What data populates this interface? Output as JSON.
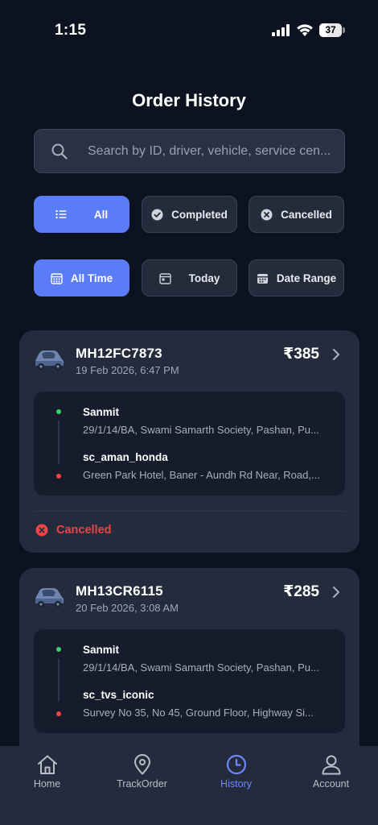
{
  "status_bar": {
    "time": "1:15",
    "battery": "37"
  },
  "page": {
    "title": "Order History"
  },
  "search": {
    "placeholder": "Search by ID, driver, vehicle, service cen..."
  },
  "status_filters": [
    {
      "label": "All",
      "icon": "list-icon",
      "active": true
    },
    {
      "label": "Completed",
      "icon": "check-circle-icon",
      "active": false
    },
    {
      "label": "Cancelled",
      "icon": "x-circle-icon",
      "active": false
    }
  ],
  "time_filters": [
    {
      "label": "All Time",
      "icon": "calendar-grid-icon",
      "active": true
    },
    {
      "label": "Today",
      "icon": "calendar-today-icon",
      "active": false
    },
    {
      "label": "Date Range",
      "icon": "calendar-range-icon",
      "active": false
    }
  ],
  "orders": [
    {
      "vehicle": "MH12FC7873",
      "datetime": "19 Feb 2026, 6:47 PM",
      "amount": "₹385",
      "pickup_name": "Sanmit",
      "pickup_address": "29/1/14/BA, Swami Samarth Society, Pashan, Pu...",
      "drop_name": "sc_aman_honda",
      "drop_address": "Green Park Hotel, Baner - Aundh Rd Near, Road,...",
      "status": "Cancelled"
    },
    {
      "vehicle": "MH13CR6115",
      "datetime": "20 Feb 2026, 3:08 AM",
      "amount": "₹285",
      "pickup_name": "Sanmit",
      "pickup_address": "29/1/14/BA, Swami Samarth Society, Pashan, Pu...",
      "drop_name": "sc_tvs_iconic",
      "drop_address": "Survey No 35, No 45, Ground Floor, Highway Si..."
    }
  ],
  "bottom_nav": [
    {
      "label": "Home",
      "icon": "home-icon",
      "active": false
    },
    {
      "label": "TrackOrder",
      "icon": "location-pin-icon",
      "active": false
    },
    {
      "label": "History",
      "icon": "clock-icon",
      "active": true
    },
    {
      "label": "Account",
      "icon": "user-icon",
      "active": false
    }
  ],
  "colors": {
    "background": "#0d1220",
    "card": "#242b3d",
    "accent": "#5b7cf7",
    "cancelled": "#ef4444",
    "pickup_dot": "#3ad16a"
  }
}
